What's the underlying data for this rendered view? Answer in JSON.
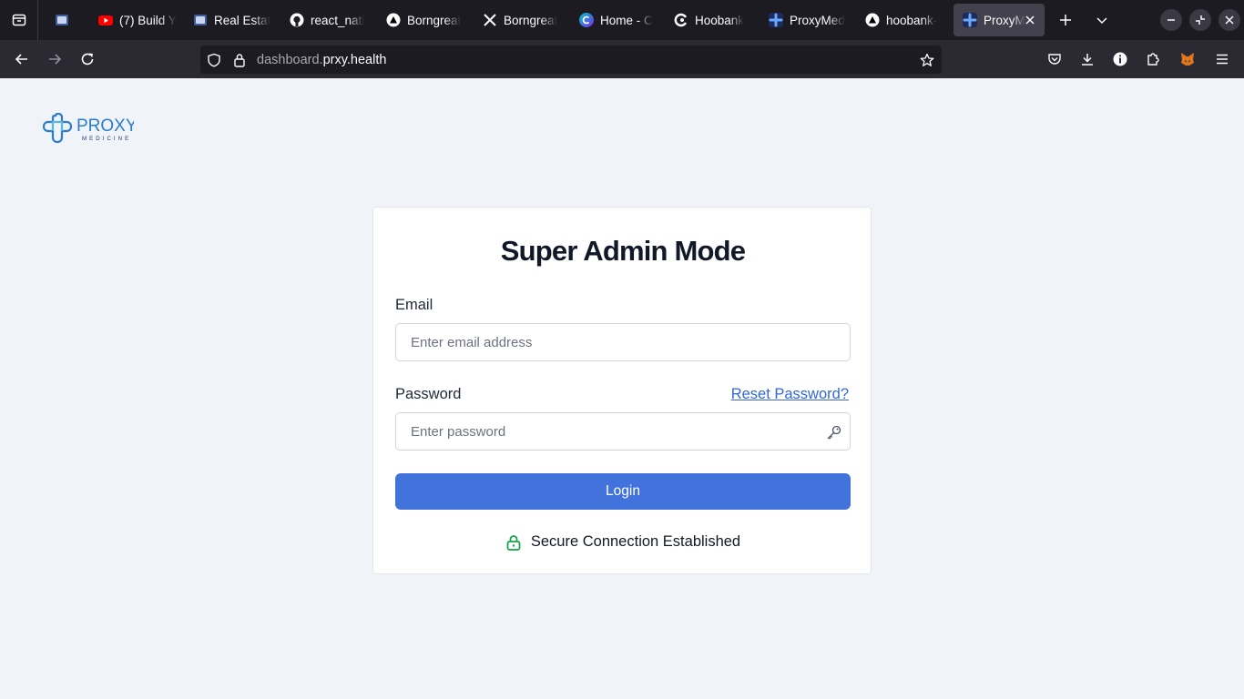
{
  "browser": {
    "tabs": [
      {
        "title": "",
        "favicon": "app-icon"
      },
      {
        "title": "(7) Build Y",
        "favicon": "youtube-icon"
      },
      {
        "title": "Real Estat",
        "favicon": "app-icon"
      },
      {
        "title": "react_nati",
        "favicon": "github-icon"
      },
      {
        "title": "Borngreat",
        "favicon": "triangle-icon"
      },
      {
        "title": "Borngreat",
        "favicon": "x-icon"
      },
      {
        "title": "Home - C",
        "favicon": "canva-icon"
      },
      {
        "title": "Hoobank",
        "favicon": "hoobank-icon"
      },
      {
        "title": "ProxyMed",
        "favicon": "proxymed-icon"
      },
      {
        "title": "hoobank-",
        "favicon": "triangle-icon"
      },
      {
        "title": "ProxyM",
        "favicon": "proxymed-icon",
        "active": true
      }
    ],
    "url": {
      "subdomain": "dashboard.",
      "domain": "prxy.health"
    }
  },
  "logo": {
    "name": "PROXY",
    "tagline": "MEDICINE"
  },
  "login": {
    "title": "Super Admin Mode",
    "email_label": "Email",
    "email_placeholder": "Enter email address",
    "password_label": "Password",
    "password_placeholder": "Enter password",
    "reset_link": "Reset Password?",
    "submit_label": "Login",
    "secure_text": "Secure Connection Established"
  },
  "colors": {
    "page_background": "#f0f4f9",
    "primary": "#4272dc",
    "link": "#3366d6",
    "secure_green": "#16a34a",
    "logo_blue": "#2a7bd1"
  }
}
